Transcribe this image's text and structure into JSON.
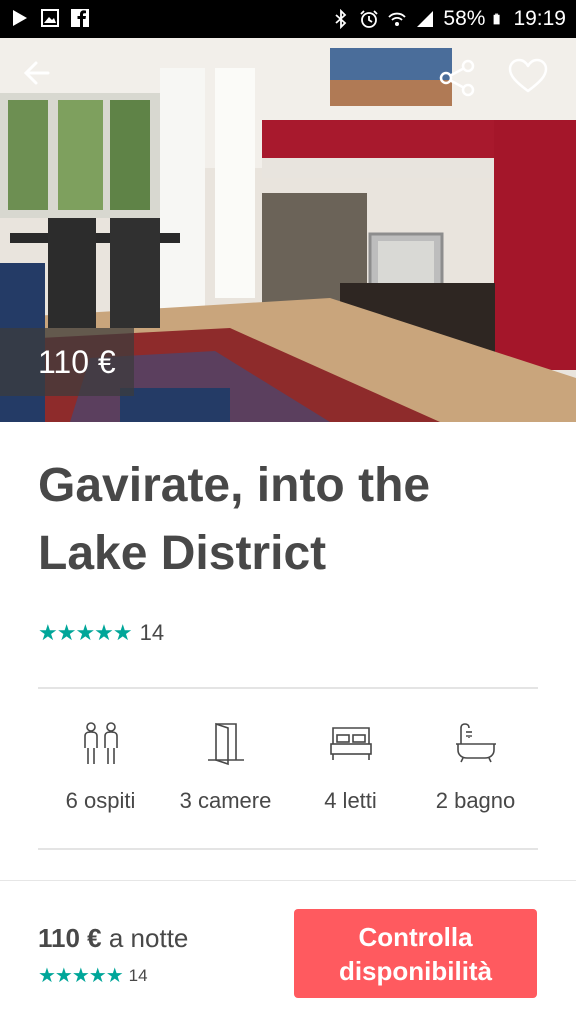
{
  "status_bar": {
    "battery": "58%",
    "time": "19:19",
    "left_icons": [
      "play-icon",
      "image-icon",
      "facebook-icon"
    ],
    "right_icons": [
      "bluetooth-icon",
      "alarm-icon",
      "wifi-icon",
      "signal-icon",
      "battery-icon"
    ]
  },
  "hero": {
    "price": "110 €",
    "back_icon": "arrow-left-icon",
    "share_icon": "share-icon",
    "favorite_icon": "heart-icon"
  },
  "listing": {
    "title": "Gavirate, into the Lake District",
    "rating_stars": "★★★★★",
    "review_count": "14"
  },
  "amenities": [
    {
      "icon": "guests-icon",
      "label": "6 ospiti"
    },
    {
      "icon": "door-icon",
      "label": "3 camere"
    },
    {
      "icon": "bed-icon",
      "label": "4 letti"
    },
    {
      "icon": "bathtub-icon",
      "label": "2 bagno"
    }
  ],
  "footer": {
    "price": "110 €",
    "price_unit": " a notte",
    "rating_stars": "★★★★★",
    "review_count": "14",
    "cta_line1": "Controlla",
    "cta_line2": "disponibilità"
  },
  "colors": {
    "accent": "#ff5a5f",
    "stars": "#00a699",
    "text": "#484848"
  }
}
